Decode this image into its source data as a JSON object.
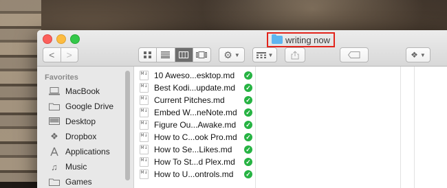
{
  "window": {
    "title": "writing now"
  },
  "toolbar": {
    "back_label": "<",
    "forward_label": ">"
  },
  "sidebar": {
    "heading": "Favorites",
    "items": [
      {
        "label": "MacBook",
        "icon": "laptop-icon"
      },
      {
        "label": "Google Drive",
        "icon": "folder-icon"
      },
      {
        "label": "Desktop",
        "icon": "desktop-icon"
      },
      {
        "label": "Dropbox",
        "icon": "dropbox-icon"
      },
      {
        "label": "Applications",
        "icon": "applications-icon"
      },
      {
        "label": "Music",
        "icon": "music-icon"
      },
      {
        "label": "Games",
        "icon": "folder-icon"
      }
    ]
  },
  "files": [
    {
      "name": "10 Aweso...esktop.md",
      "synced": true
    },
    {
      "name": "Best Kodi...update.md",
      "synced": true
    },
    {
      "name": "Current Pitches.md",
      "synced": true
    },
    {
      "name": "Embed W...neNote.md",
      "synced": true
    },
    {
      "name": "Figure Ou...Awake.md",
      "synced": true
    },
    {
      "name": "How to C...ook Pro.md",
      "synced": true
    },
    {
      "name": "How to Se...Likes.md",
      "synced": true
    },
    {
      "name": "How To St...d Plex.md",
      "synced": true
    },
    {
      "name": "How to U...ontrols.md",
      "synced": true
    }
  ],
  "colors": {
    "accent_highlight": "#e2231a",
    "sync_check": "#27b343",
    "folder_blue": "#5eb5f0"
  }
}
